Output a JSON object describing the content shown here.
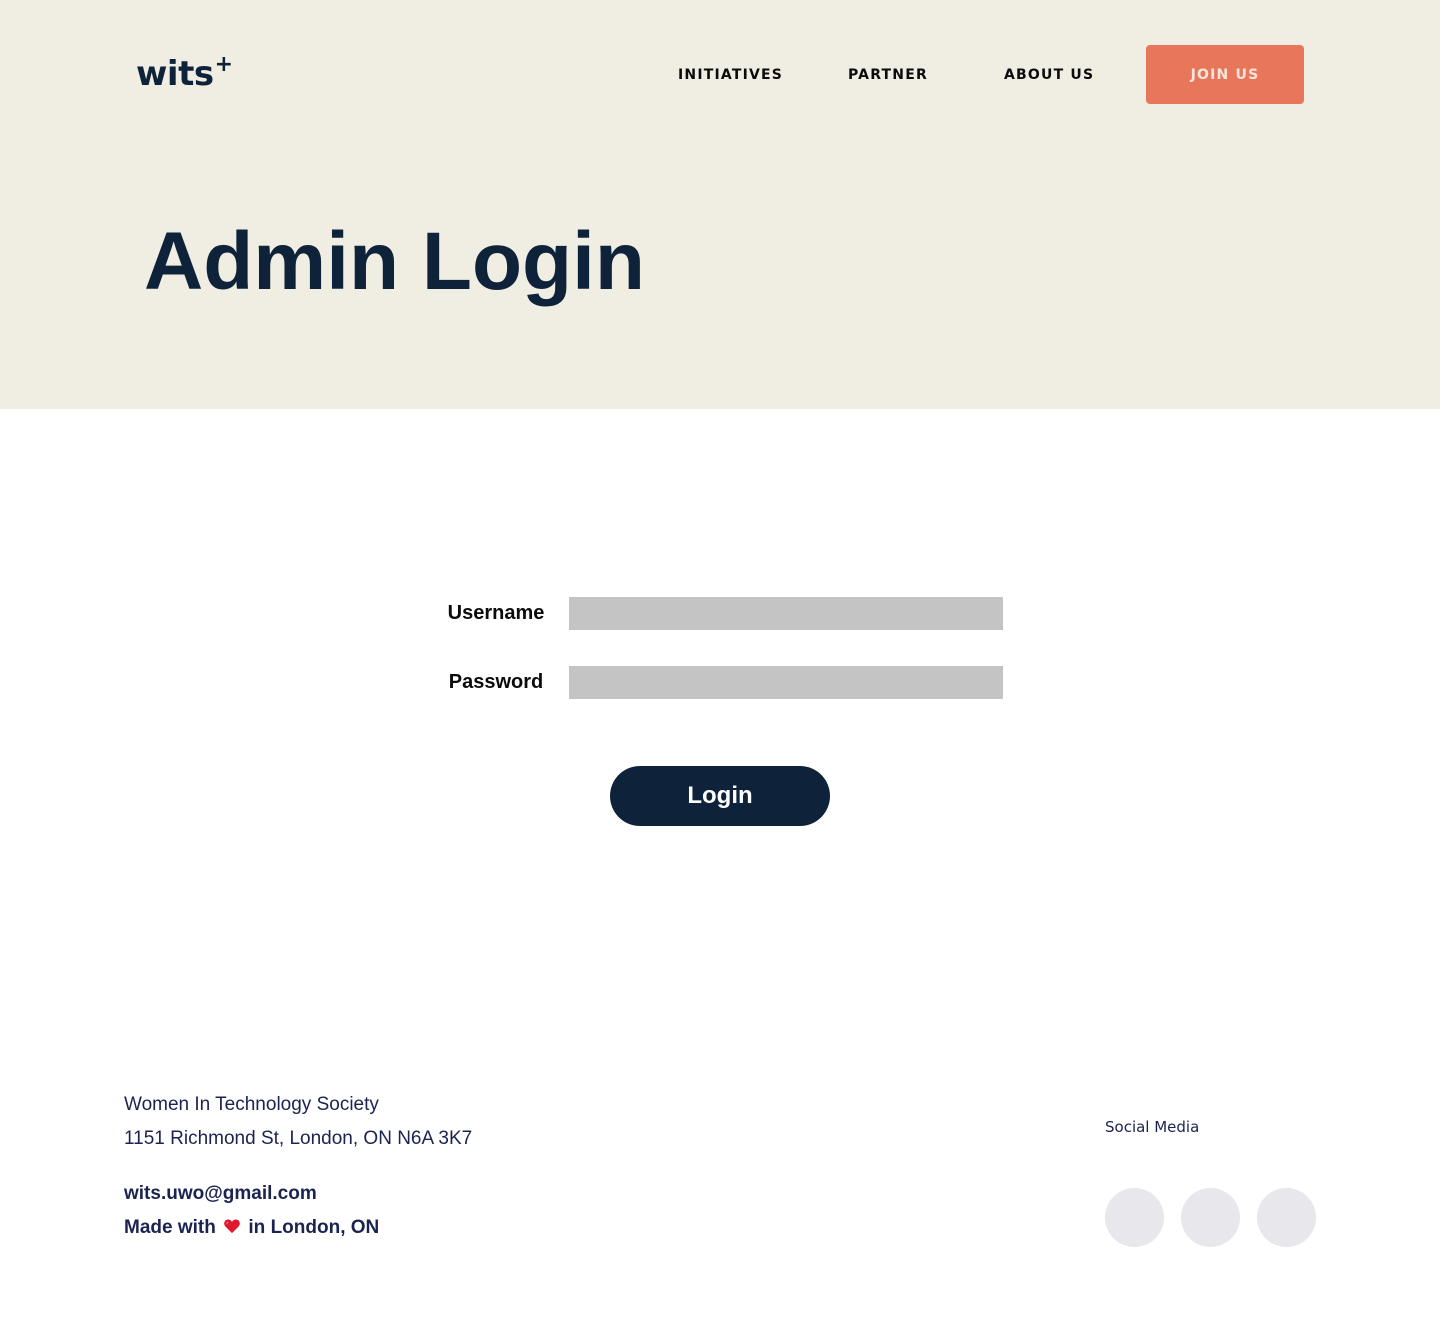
{
  "header": {
    "logo_text": "wits",
    "logo_plus": "+",
    "nav": [
      {
        "label": "INITIATIVES"
      },
      {
        "label": "PARTNER"
      },
      {
        "label": "ABOUT US"
      }
    ],
    "join_label": "JOIN US"
  },
  "hero": {
    "title": "Admin Login"
  },
  "form": {
    "username_label": "Username",
    "username_value": "",
    "password_label": "Password",
    "password_value": "",
    "login_label": "Login"
  },
  "footer": {
    "org_name": "Women In Technology Society",
    "address": "1151 Richmond St, London, ON N6A 3K7",
    "email": "wits.uwo@gmail.com",
    "made_with_prefix": "Made with",
    "made_with_suffix": "in London, ON",
    "social_label": "Social Media",
    "social_icons": [
      "social-icon-1",
      "social-icon-2",
      "social-icon-3"
    ]
  },
  "colors": {
    "hero_bg": "#f0eee2",
    "brand_navy": "#0e2239",
    "accent_orange": "#e8765a",
    "input_gray": "#c4c4c4",
    "footer_text": "#1b2350",
    "social_circle": "#e7e7ec",
    "heart_red": "#e0182d"
  }
}
